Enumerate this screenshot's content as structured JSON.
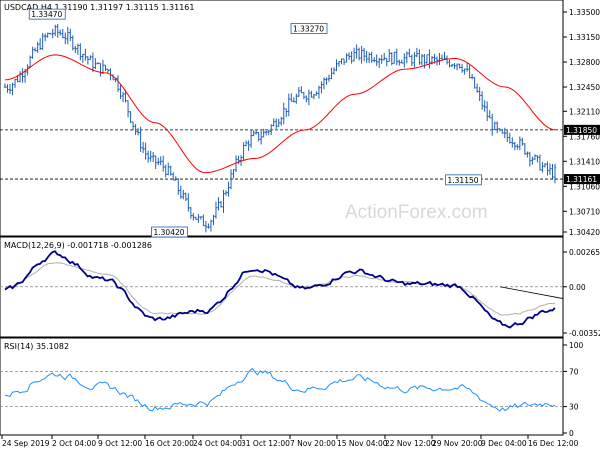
{
  "main": {
    "header": "USDCAD,H4  1.31190 1.31197 1.31115 1.31161",
    "watermark": "ActionForex.com",
    "price_axis": [
      "1.33500",
      "1.33150",
      "1.32800",
      "1.32450",
      "1.32110",
      "1.31760",
      "1.31410",
      "1.31060",
      "1.30710",
      "1.30420"
    ],
    "callouts": [
      "1.33470",
      "1.33270",
      "1.30420",
      "1.31150"
    ],
    "level_labels": [
      "1.31850",
      "1.31161"
    ],
    "colors": {
      "price": "#1e5fb4",
      "ema": "#ff0000",
      "macd_line": "#00008b",
      "macd_signal": "#b0b0b0",
      "rsi": "#1e90ff",
      "level": "#000000"
    }
  },
  "macd": {
    "header": "MACD(12,26,9) -0.001718 -0.001286",
    "axis": [
      "0.002652",
      "0.00",
      "-0.003526"
    ]
  },
  "rsi": {
    "header": "RSI(14) 35.1082",
    "axis": [
      "100",
      "70",
      "30",
      "0"
    ]
  },
  "time_axis": [
    "24 Sep 2019",
    "2 Oct 04:00",
    "9 Oct 12:00",
    "16 Oct 20:00",
    "24 Oct 04:00",
    "31 Oct 12:00",
    "7 Nov 20:00",
    "15 Nov 04:00",
    "22 Nov 12:00",
    "29 Nov 20:00",
    "9 Dec 04:00",
    "16 Dec 12:00"
  ],
  "chart_data": {
    "type": "line",
    "title": "USDCAD,H4",
    "ohlc_last": {
      "open": 1.3119,
      "high": 1.31197,
      "low": 1.31115,
      "close": 1.31161
    },
    "x": [
      "24 Sep 2019",
      "2 Oct 04:00",
      "9 Oct 12:00",
      "16 Oct 20:00",
      "24 Oct 04:00",
      "31 Oct 12:00",
      "7 Nov 20:00",
      "15 Nov 04:00",
      "22 Nov 12:00",
      "29 Nov 20:00",
      "9 Dec 04:00",
      "16 Dec 12:00"
    ],
    "series": [
      {
        "values": [
          1.3245,
          1.3322,
          1.327,
          1.314,
          1.3055,
          1.3175,
          1.3235,
          1.329,
          1.3285,
          1.328,
          1.3175,
          1.3125
        ]
      },
      {
        "values": [
          1.3255,
          1.329,
          1.3265,
          1.3195,
          1.3125,
          1.3145,
          1.3185,
          1.3235,
          1.327,
          1.3285,
          1.3245,
          1.3185
        ]
      }
    ],
    "levels": [
      1.3185,
      1.31161
    ],
    "ylim": [
      1.3042,
      1.335
    ],
    "macd": {
      "ylim": [
        -0.003526,
        0.002652
      ],
      "series": [
        {
          "values": [
            -0.0003,
            0.0025,
            0.0005,
            -0.0025,
            -0.0018,
            0.0015,
            -0.0002,
            0.0012,
            0.0002,
            0.0001,
            -0.003,
            -0.0017
          ]
        },
        {
          "values": [
            -0.0001,
            0.0018,
            0.001,
            -0.002,
            -0.002,
            0.0008,
            0.0,
            0.0008,
            0.0003,
            0.0001,
            -0.0022,
            -0.0013
          ]
        }
      ]
    },
    "rsi": {
      "ylim": [
        0,
        100
      ],
      "levels": [
        70,
        30
      ],
      "series": [
        {
          "values": [
            45,
            67,
            52,
            30,
            35,
            70,
            50,
            62,
            50,
            52,
            28,
            35.1
          ]
        }
      ]
    }
  }
}
